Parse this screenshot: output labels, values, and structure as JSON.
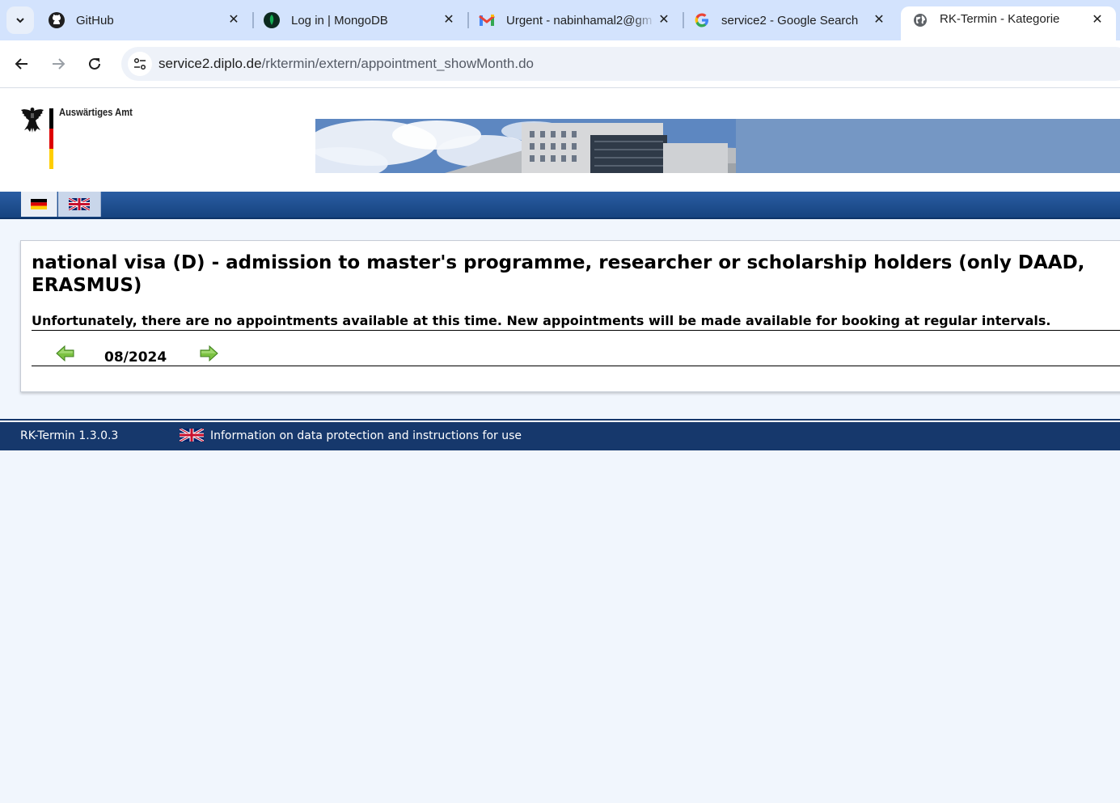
{
  "browser": {
    "tabs": [
      {
        "title": "GitHub",
        "icon": "github-icon"
      },
      {
        "title": "Log in | MongoDB",
        "icon": "mongodb-leaf-icon"
      },
      {
        "title": "Urgent - nabinhamal2@gm",
        "icon": "gmail-icon"
      },
      {
        "title": "service2 - Google Search",
        "icon": "google-icon"
      },
      {
        "title": "RK-Termin - Kategorie",
        "icon": "globe-icon",
        "active": true
      }
    ],
    "url": {
      "host": "service2.diplo.de",
      "path": "/rktermin/extern/appointment_showMonth.do"
    }
  },
  "header": {
    "brand": "Auswärtiges Amt",
    "flag_colors": [
      "#000000",
      "#dd0000",
      "#ffce00"
    ]
  },
  "languages": [
    {
      "code": "de",
      "icon": "german-flag-icon"
    },
    {
      "code": "en",
      "icon": "uk-flag-icon",
      "selected": true
    }
  ],
  "content": {
    "category_title": "national visa (D) - admission to master's programme, researcher or scholarship holders (only DAAD, ERASMUS)",
    "notice": "Unfortunately, there are no appointments available at this time. New appointments will be made available for booking at regular intervals.",
    "month": "08/2024"
  },
  "footer": {
    "version": "RK-Termin 1.3.0.3",
    "info_link": "Information on data protection and instructions for use"
  },
  "colors": {
    "page_bg": "#f1f6fd",
    "nav_blue": "#16386c",
    "tabstrip": "#d3e3fd"
  }
}
